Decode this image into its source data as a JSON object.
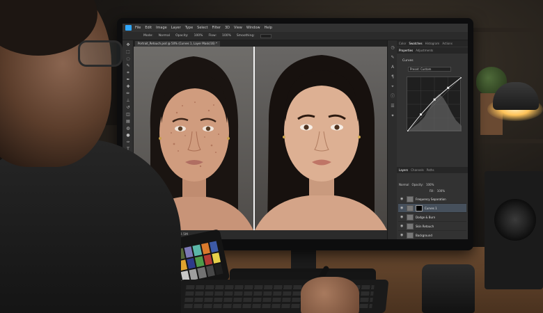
{
  "app": {
    "menu": [
      "File",
      "Edit",
      "Image",
      "Layer",
      "Type",
      "Select",
      "Filter",
      "3D",
      "View",
      "Window",
      "Help"
    ],
    "options_bar": {
      "mode_label": "Mode:",
      "mode_value": "Normal",
      "opacity_label": "Opacity:",
      "opacity_value": "100%",
      "flow_label": "Flow:",
      "flow_value": "100%",
      "smoothing_label": "Smoothing:"
    },
    "document_tab": "Portrait_Retouch.psd @ 50% (Curves 1, Layer Mask/16) *",
    "status": {
      "zoom": "50%",
      "doc": "Doc: 68.0M/232.5M"
    },
    "panel_tabs_top": [
      "Color",
      "Swatches",
      "Histogram",
      "Actions"
    ],
    "properties_tabs": [
      "Properties",
      "Adjustments"
    ],
    "properties_title": "Curves",
    "preset_value": "Preset: Custom",
    "layers_tabs": [
      "Layers",
      "Channels",
      "Paths"
    ],
    "blend_mode": "Normal",
    "opacity_label": "Opacity:",
    "opacity_value": "100%",
    "fill_label": "Fill:",
    "fill_value": "100%",
    "layers": [
      "Frequency Separation",
      "Curves 1",
      "Dodge & Burn",
      "Skin Retouch",
      "Background"
    ],
    "selected_layer_index": 1
  },
  "colors": {
    "ps_blue": "#31a8ff",
    "panel_bg": "#323232",
    "lamp_glow": "#ffc45a",
    "checker": [
      "#7b4a2c",
      "#c59a7a",
      "#5f7fa8",
      "#56683b",
      "#7b78b4",
      "#5bb7a8",
      "#d97a2c",
      "#3d5aa6",
      "#c24b5c",
      "#4f3366",
      "#a7c43f",
      "#e0a22e",
      "#2d3a8a",
      "#4e9a4a",
      "#b23a34",
      "#e6d04a",
      "#b8488f",
      "#2d86a8",
      "#f2f2f2",
      "#c8c8c8",
      "#9f9f9f",
      "#727272",
      "#474747",
      "#1f1f1f"
    ]
  },
  "chart_data": {
    "type": "line",
    "title": "",
    "xlabel": "",
    "ylabel": "",
    "x": [
      0,
      64,
      128,
      192,
      255
    ],
    "y": [
      0,
      80,
      150,
      205,
      255
    ],
    "xlim": [
      0,
      255
    ],
    "ylim": [
      0,
      255
    ]
  }
}
